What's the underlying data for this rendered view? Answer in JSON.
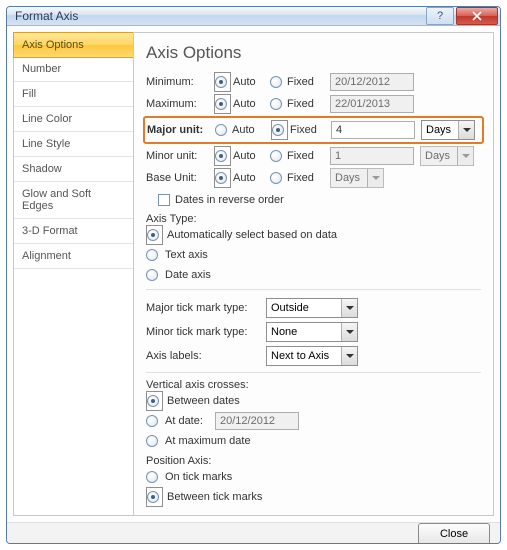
{
  "window": {
    "title": "Format Axis"
  },
  "sidebar": {
    "items": [
      "Axis Options",
      "Number",
      "Fill",
      "Line Color",
      "Line Style",
      "Shadow",
      "Glow and Soft Edges",
      "3-D Format",
      "Alignment"
    ],
    "active_index": 0
  },
  "heading": "Axis Options",
  "bounds": {
    "minimum": {
      "label": "Minimum:",
      "auto": "Auto",
      "fixed": "Fixed",
      "value": "20/12/2012",
      "mode": "auto"
    },
    "maximum": {
      "label": "Maximum:",
      "auto": "Auto",
      "fixed": "Fixed",
      "value": "22/01/2013",
      "mode": "auto"
    },
    "major": {
      "label": "Major unit:",
      "auto": "Auto",
      "fixed": "Fixed",
      "value": "4",
      "unit": "Days",
      "mode": "fixed"
    },
    "minor": {
      "label": "Minor unit:",
      "auto": "Auto",
      "fixed": "Fixed",
      "value": "1",
      "unit": "Days",
      "mode": "auto"
    },
    "base": {
      "label": "Base Unit:",
      "auto": "Auto",
      "fixed": "Fixed",
      "unit": "Days",
      "mode": "auto"
    }
  },
  "reverse": {
    "label": "Dates in reverse order",
    "checked": false
  },
  "axis_type": {
    "label": "Axis Type:",
    "options": {
      "auto": "Automatically select based on data",
      "text": "Text axis",
      "date": "Date axis"
    },
    "selected": "auto"
  },
  "ticks": {
    "major": {
      "label": "Major tick mark type:",
      "value": "Outside"
    },
    "minor": {
      "label": "Minor tick mark type:",
      "value": "None"
    },
    "labels": {
      "label": "Axis labels:",
      "value": "Next to Axis"
    }
  },
  "crosses": {
    "label": "Vertical axis crosses:",
    "between": "Between dates",
    "at_date": "At date:",
    "at_date_value": "20/12/2012",
    "at_max": "At maximum date",
    "selected": "between"
  },
  "position": {
    "label": "Position Axis:",
    "on": "On tick marks",
    "between": "Between tick marks",
    "selected": "between"
  },
  "footer": {
    "close": "Close"
  }
}
